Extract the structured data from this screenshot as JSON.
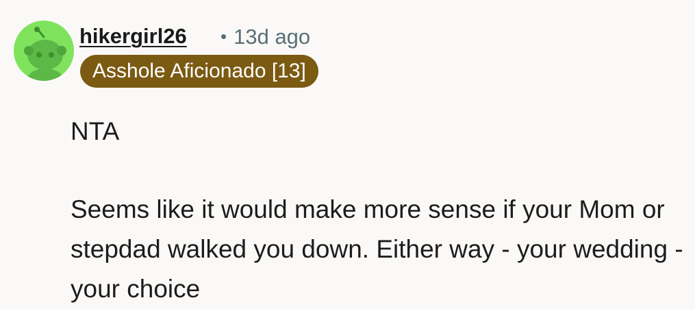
{
  "comment": {
    "username": "hikergirl26",
    "separator": "•",
    "age": "13d ago",
    "flair": "Asshole Aficionado [13]",
    "paragraphs": [
      "NTA",
      "Seems like it would make more sense if your Mom or stepdad walked you down. Either way - your wedding - your choice"
    ]
  },
  "colors": {
    "avatar_bg": "#7fe35d",
    "flair_bg": "#7b5a12",
    "meta_text": "#576f76",
    "page_bg": "#fbf9f7"
  },
  "icons": {
    "avatar": "snoo-avatar-icon"
  }
}
